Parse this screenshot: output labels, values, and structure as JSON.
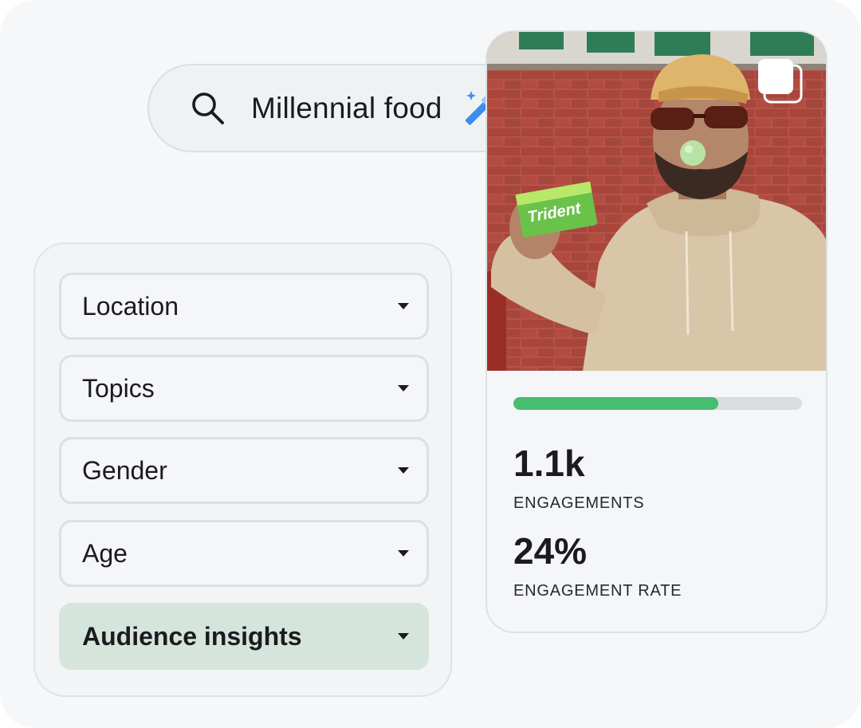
{
  "search": {
    "query": "Millennial food",
    "icon": "search-icon",
    "ai_icon": "magic-wand-icon"
  },
  "filters": {
    "items": [
      {
        "label": "Location",
        "icon": "chevron-down-icon"
      },
      {
        "label": "Topics",
        "icon": "chevron-down-icon"
      },
      {
        "label": "Gender",
        "icon": "chevron-down-icon"
      },
      {
        "label": "Age",
        "icon": "chevron-down-icon"
      },
      {
        "label": "Audience insights",
        "icon": "chevron-down-icon",
        "selected": true
      }
    ]
  },
  "post": {
    "media_icon": "multiple-images-icon",
    "progress_fraction": 0.71,
    "engagements_value": "1.1k",
    "engagements_label": "ENGAGEMENTS",
    "rate_value": "24%",
    "rate_label": "ENGAGEMENT RATE"
  },
  "colors": {
    "accent_green": "#47bd6f",
    "selected_filter_bg": "#d5e5dc",
    "wand_blue": "#3b8df0"
  }
}
